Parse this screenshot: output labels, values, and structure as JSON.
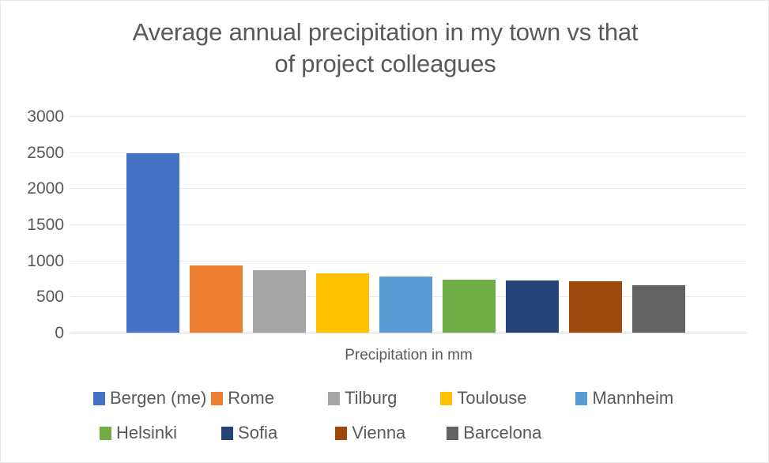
{
  "chart_data": {
    "type": "bar",
    "title": "Average annual precipitation in my town vs that\nof project colleagues",
    "title_line_1": "Average annual precipitation in my town vs that",
    "title_line_2": "of project colleagues",
    "xlabel": "Precipitation in mm",
    "ylabel": "",
    "ylim": [
      0,
      3000
    ],
    "ytick_labels": [
      "3000",
      "2500",
      "2000",
      "1500",
      "1000",
      "500",
      "0"
    ],
    "ytick_values": [
      3000,
      2500,
      2000,
      1500,
      1000,
      500,
      0
    ],
    "grid": true,
    "legend_position": "bottom",
    "categories": [
      "Bergen (me)",
      "Rome",
      "Tilburg",
      "Toulouse",
      "Mannheim",
      "Helsinki",
      "Sofia",
      "Vienna",
      "Barcelona"
    ],
    "values": [
      2490,
      930,
      860,
      825,
      775,
      735,
      725,
      715,
      655
    ],
    "colors": [
      "#4472C4",
      "#ED7D31",
      "#A5A5A5",
      "#FFC000",
      "#5B9BD5",
      "#70AD47",
      "#264478",
      "#9E480E",
      "#636363"
    ],
    "series": [
      {
        "name": "Precipitation in mm",
        "points": [
          {
            "label": "Bergen (me)",
            "value": 2490,
            "color": "#4472C4"
          },
          {
            "label": "Rome",
            "value": 930,
            "color": "#ED7D31"
          },
          {
            "label": "Tilburg",
            "value": 860,
            "color": "#A5A5A5"
          },
          {
            "label": "Toulouse",
            "value": 825,
            "color": "#FFC000"
          },
          {
            "label": "Mannheim",
            "value": 775,
            "color": "#5B9BD5"
          },
          {
            "label": "Helsinki",
            "value": 735,
            "color": "#70AD47"
          },
          {
            "label": "Sofia",
            "value": 725,
            "color": "#264478"
          },
          {
            "label": "Vienna",
            "value": 715,
            "color": "#9E480E"
          },
          {
            "label": "Barcelona",
            "value": 655,
            "color": "#636363"
          }
        ]
      }
    ]
  },
  "legend": {
    "row1": [
      {
        "label": "Bergen (me)",
        "color": "#4472C4"
      },
      {
        "label": "Rome",
        "color": "#ED7D31"
      },
      {
        "label": "Tilburg",
        "color": "#A5A5A5"
      },
      {
        "label": "Toulouse",
        "color": "#FFC000"
      },
      {
        "label": "Mannheim",
        "color": "#5B9BD5"
      }
    ],
    "row2": [
      {
        "label": "Helsinki",
        "color": "#70AD47"
      },
      {
        "label": "Sofia",
        "color": "#264478"
      },
      {
        "label": "Vienna",
        "color": "#9E480E"
      },
      {
        "label": "Barcelona",
        "color": "#636363"
      }
    ]
  }
}
